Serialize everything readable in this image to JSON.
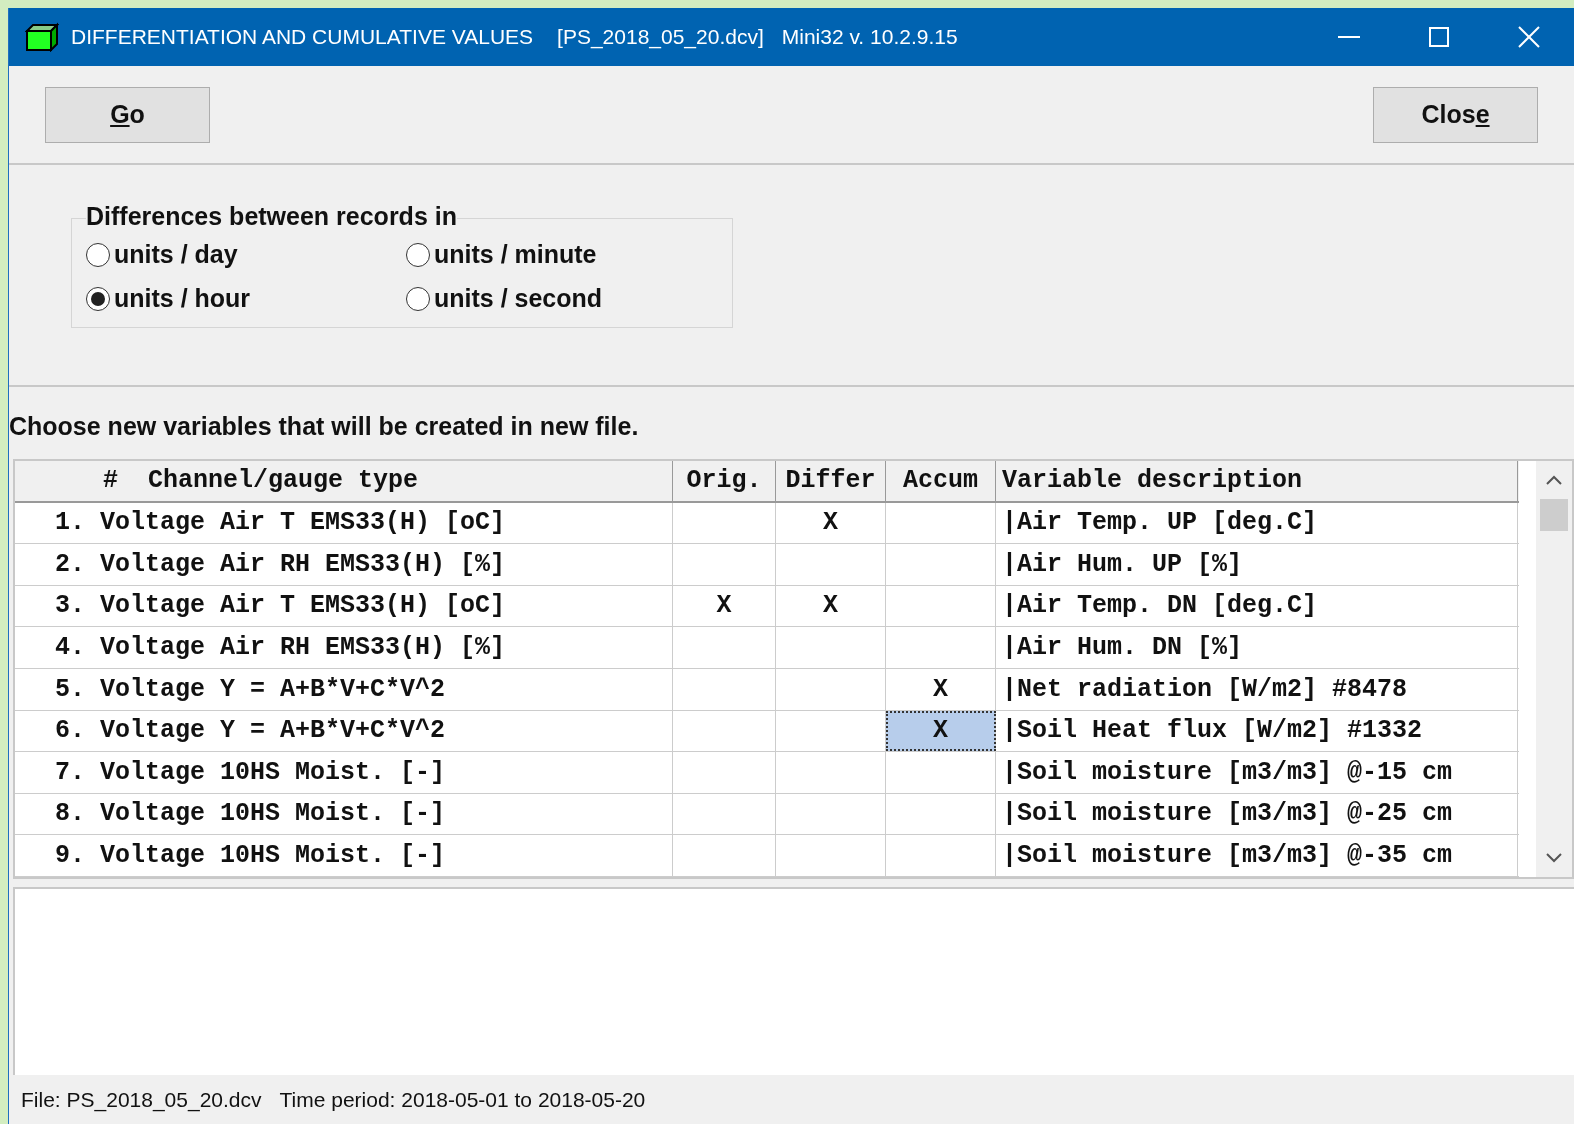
{
  "window": {
    "title": "DIFFERENTIATION AND CUMULATIVE VALUES",
    "file": "[PS_2018_05_20.dcv]",
    "version": "Mini32 v. 10.2.9.15"
  },
  "buttons": [
    {
      "label": [
        {
          "text": "G",
          "underlined": true
        },
        {
          "text": "o",
          "underlined": false
        }
      ]
    },
    {
      "label": [
        {
          "text": "Clos",
          "underlined": false
        },
        {
          "text": "e",
          "underlined": true
        }
      ]
    }
  ],
  "group": {
    "title": "Differences between records in",
    "options": [
      {
        "label": "units / day",
        "selected": false
      },
      {
        "label": "units / minute",
        "selected": false
      },
      {
        "label": "units / hour",
        "selected": true
      },
      {
        "label": "units / second",
        "selected": false
      }
    ]
  },
  "instruction": "Choose new variables that will be created in new file.",
  "table": {
    "columns": [
      "#  Channel/gauge type",
      "Orig.",
      "Differ",
      "Accum",
      "Variable description"
    ],
    "rows": [
      {
        "cells": [
          {
            "text": "1. Voltage Air T EMS33(H) [oC]",
            "selected": false
          },
          {
            "text": "",
            "selected": false
          },
          {
            "text": "X",
            "selected": false
          },
          {
            "text": "",
            "selected": false
          },
          {
            "text": "|Air Temp. UP [deg.C]",
            "selected": false
          }
        ]
      },
      {
        "cells": [
          {
            "text": "2. Voltage Air RH EMS33(H) [%]",
            "selected": false
          },
          {
            "text": "",
            "selected": false
          },
          {
            "text": "",
            "selected": false
          },
          {
            "text": "",
            "selected": false
          },
          {
            "text": "|Air Hum. UP [%]",
            "selected": false
          }
        ]
      },
      {
        "cells": [
          {
            "text": "3. Voltage Air T EMS33(H) [oC]",
            "selected": false
          },
          {
            "text": "X",
            "selected": false
          },
          {
            "text": "X",
            "selected": false
          },
          {
            "text": "",
            "selected": false
          },
          {
            "text": "|Air Temp. DN [deg.C]",
            "selected": false
          }
        ]
      },
      {
        "cells": [
          {
            "text": "4. Voltage Air RH EMS33(H) [%]",
            "selected": false
          },
          {
            "text": "",
            "selected": false
          },
          {
            "text": "",
            "selected": false
          },
          {
            "text": "",
            "selected": false
          },
          {
            "text": "|Air Hum. DN [%]",
            "selected": false
          }
        ]
      },
      {
        "cells": [
          {
            "text": "5. Voltage Y = A+B*V+C*V^2",
            "selected": false
          },
          {
            "text": "",
            "selected": false
          },
          {
            "text": "",
            "selected": false
          },
          {
            "text": "X",
            "selected": false
          },
          {
            "text": "|Net radiation [W/m2] #8478",
            "selected": false
          }
        ]
      },
      {
        "cells": [
          {
            "text": "6. Voltage Y = A+B*V+C*V^2",
            "selected": false
          },
          {
            "text": "",
            "selected": false
          },
          {
            "text": "",
            "selected": false
          },
          {
            "text": "X",
            "selected": true
          },
          {
            "text": "|Soil Heat flux [W/m2] #1332",
            "selected": false
          }
        ]
      },
      {
        "cells": [
          {
            "text": "7. Voltage 10HS Moist. [-]",
            "selected": false
          },
          {
            "text": "",
            "selected": false
          },
          {
            "text": "",
            "selected": false
          },
          {
            "text": "",
            "selected": false
          },
          {
            "text": "|Soil moisture [m3/m3] @-15 cm",
            "selected": false
          }
        ]
      },
      {
        "cells": [
          {
            "text": "8. Voltage 10HS Moist. [-]",
            "selected": false
          },
          {
            "text": "",
            "selected": false
          },
          {
            "text": "",
            "selected": false
          },
          {
            "text": "",
            "selected": false
          },
          {
            "text": "|Soil moisture [m3/m3] @-25 cm",
            "selected": false
          }
        ]
      },
      {
        "cells": [
          {
            "text": "9. Voltage 10HS Moist. [-]",
            "selected": false
          },
          {
            "text": "",
            "selected": false
          },
          {
            "text": "",
            "selected": false
          },
          {
            "text": "",
            "selected": false
          },
          {
            "text": "|Soil moisture [m3/m3] @-35 cm",
            "selected": false
          }
        ]
      }
    ]
  },
  "status_bar": {
    "file": "File: PS_2018_05_20.dcv",
    "period": "Time period: 2018-05-01 to 2018-05-20"
  }
}
